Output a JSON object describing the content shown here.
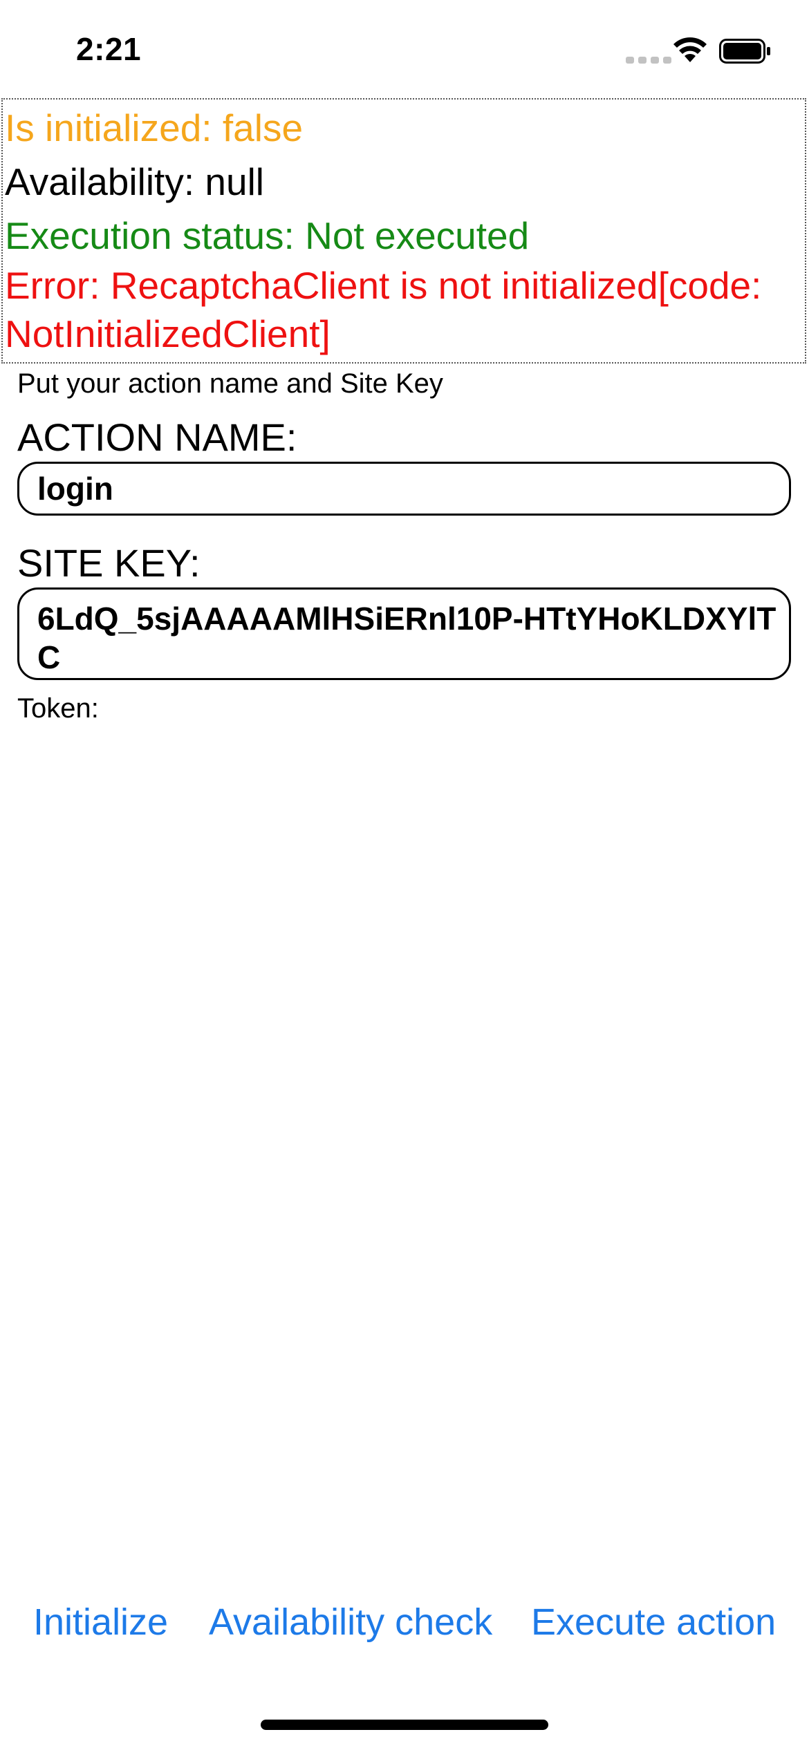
{
  "status_bar": {
    "time": "2:21"
  },
  "status": {
    "initialized": "Is initialized: false",
    "availability": "Availability: null",
    "execution": "Execution status: Not executed",
    "error": "Error: RecaptchaClient is not initialized[code: NotInitializedClient]"
  },
  "form": {
    "hint": "Put your action name and Site Key",
    "action_label": "ACTION NAME:",
    "action_value": "login",
    "site_key_label": "SITE KEY:",
    "site_key_value": "6LdQ_5sjAAAAAMlHSiERnl10P-HTtYHoKLDXYlTC",
    "token_label": "Token:",
    "token_value": ""
  },
  "buttons": {
    "initialize": "Initialize",
    "availability_check": "Availability check",
    "execute_action": "Execute action"
  },
  "colors": {
    "initialized": "#f5a61c",
    "execution": "#168a16",
    "error": "#ee1111",
    "link": "#1d7ae8"
  },
  "icons": [
    "cellular-signal-icon",
    "wifi-icon",
    "battery-icon"
  ]
}
